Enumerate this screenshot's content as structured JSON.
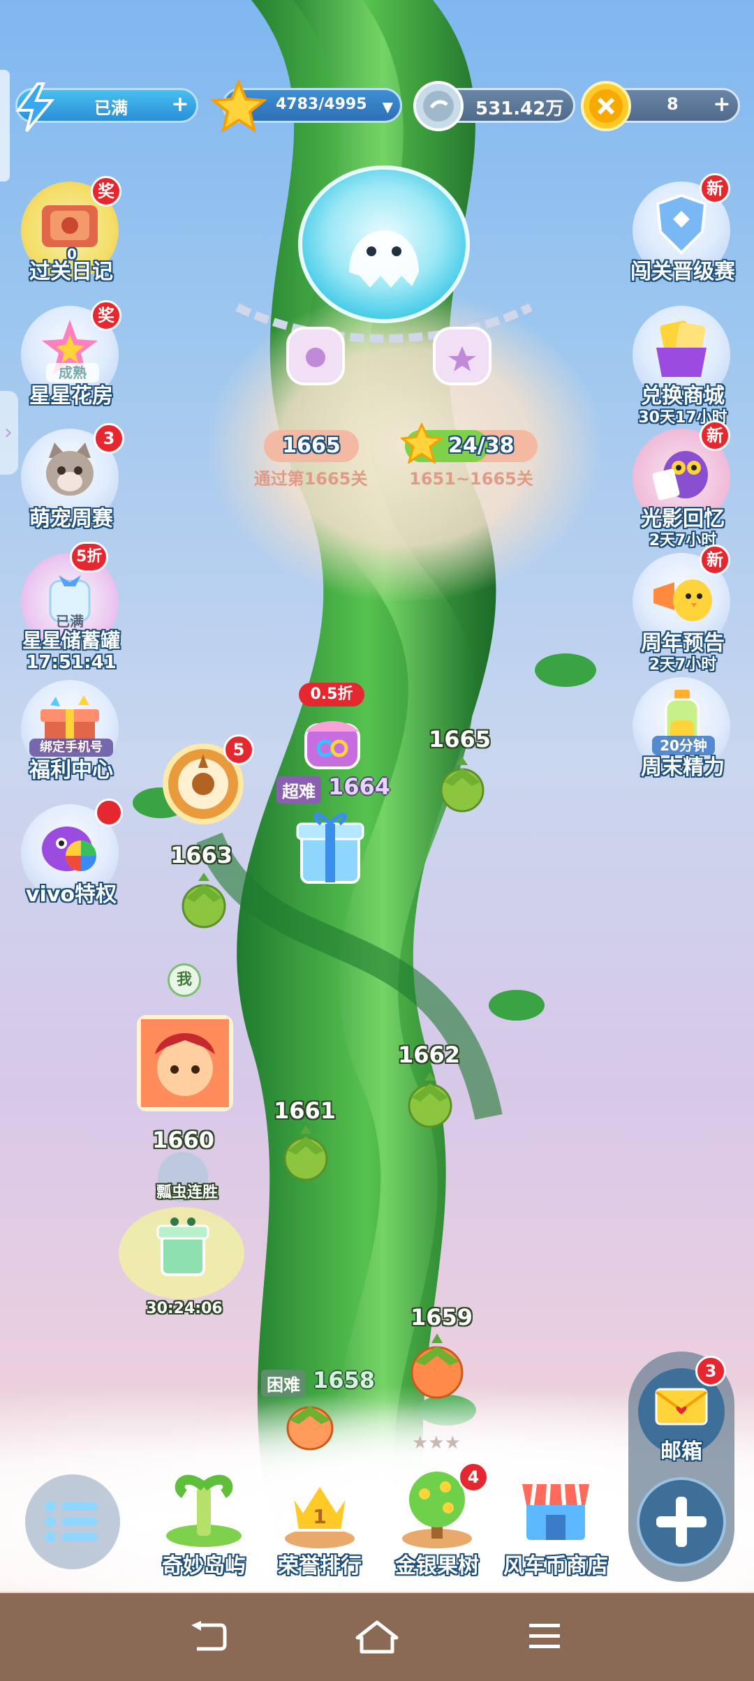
{
  "resources": {
    "energy": {
      "value": "已满",
      "icon": "lightning-icon"
    },
    "stars": {
      "value": "4783/4995",
      "icon": "star-icon"
    },
    "coins": {
      "value": "531.42万",
      "icon": "silver-coin-icon"
    },
    "gold": {
      "value": "8",
      "icon": "gold-coin-icon"
    }
  },
  "left_buttons": [
    {
      "label": "过关日记",
      "badge": "奖",
      "extra": "0"
    },
    {
      "label": "星星花房",
      "badge": "奖",
      "extra": "成熟"
    },
    {
      "label": "萌宠周赛",
      "badge": "3"
    },
    {
      "label": "星星储蓄罐",
      "badge": "5折",
      "extra": "已满",
      "timer": "17:51:41"
    },
    {
      "label": "福利中心",
      "extra": "绑定手机号"
    },
    {
      "label": "vivo特权"
    }
  ],
  "right_buttons": [
    {
      "label": "闯关晋级赛",
      "badge": "新"
    },
    {
      "label": "兑换商城",
      "sub": "30天17小时"
    },
    {
      "label": "光影回忆",
      "badge": "新",
      "sub": "2天7小时"
    },
    {
      "label": "周年预告",
      "badge": "新",
      "sub": "2天7小时"
    },
    {
      "label": "周末精力",
      "extra": "20分钟"
    }
  ],
  "chest": {
    "level_badge": "1665",
    "level_caption": "通过第1665关",
    "stars_badge": "24/38",
    "stars_caption": "1651~1665关"
  },
  "levels": {
    "l1665": "1665",
    "l1664": "1664",
    "l1664_tag": "超难",
    "l1664_discount": "0.5折",
    "l1663": "1663",
    "l1662": "1662",
    "l1661": "1661",
    "l1660": "1660",
    "l1659": "1659",
    "l1658": "1658",
    "l1658_tag": "困难",
    "wheel_badge": "5",
    "me_label": "我",
    "streak_label": "瓢虫连胜",
    "streak_timer": "30:24:06"
  },
  "mailbox": {
    "label": "邮箱",
    "badge": "3"
  },
  "bottom_nav": [
    {
      "label": "奇妙岛屿"
    },
    {
      "label": "荣誉排行"
    },
    {
      "label": "金银果树",
      "badge": "4"
    },
    {
      "label": "风车币商店"
    }
  ],
  "system_nav": {
    "back": "back-icon",
    "home": "home-icon",
    "menu": "menu-icon"
  }
}
